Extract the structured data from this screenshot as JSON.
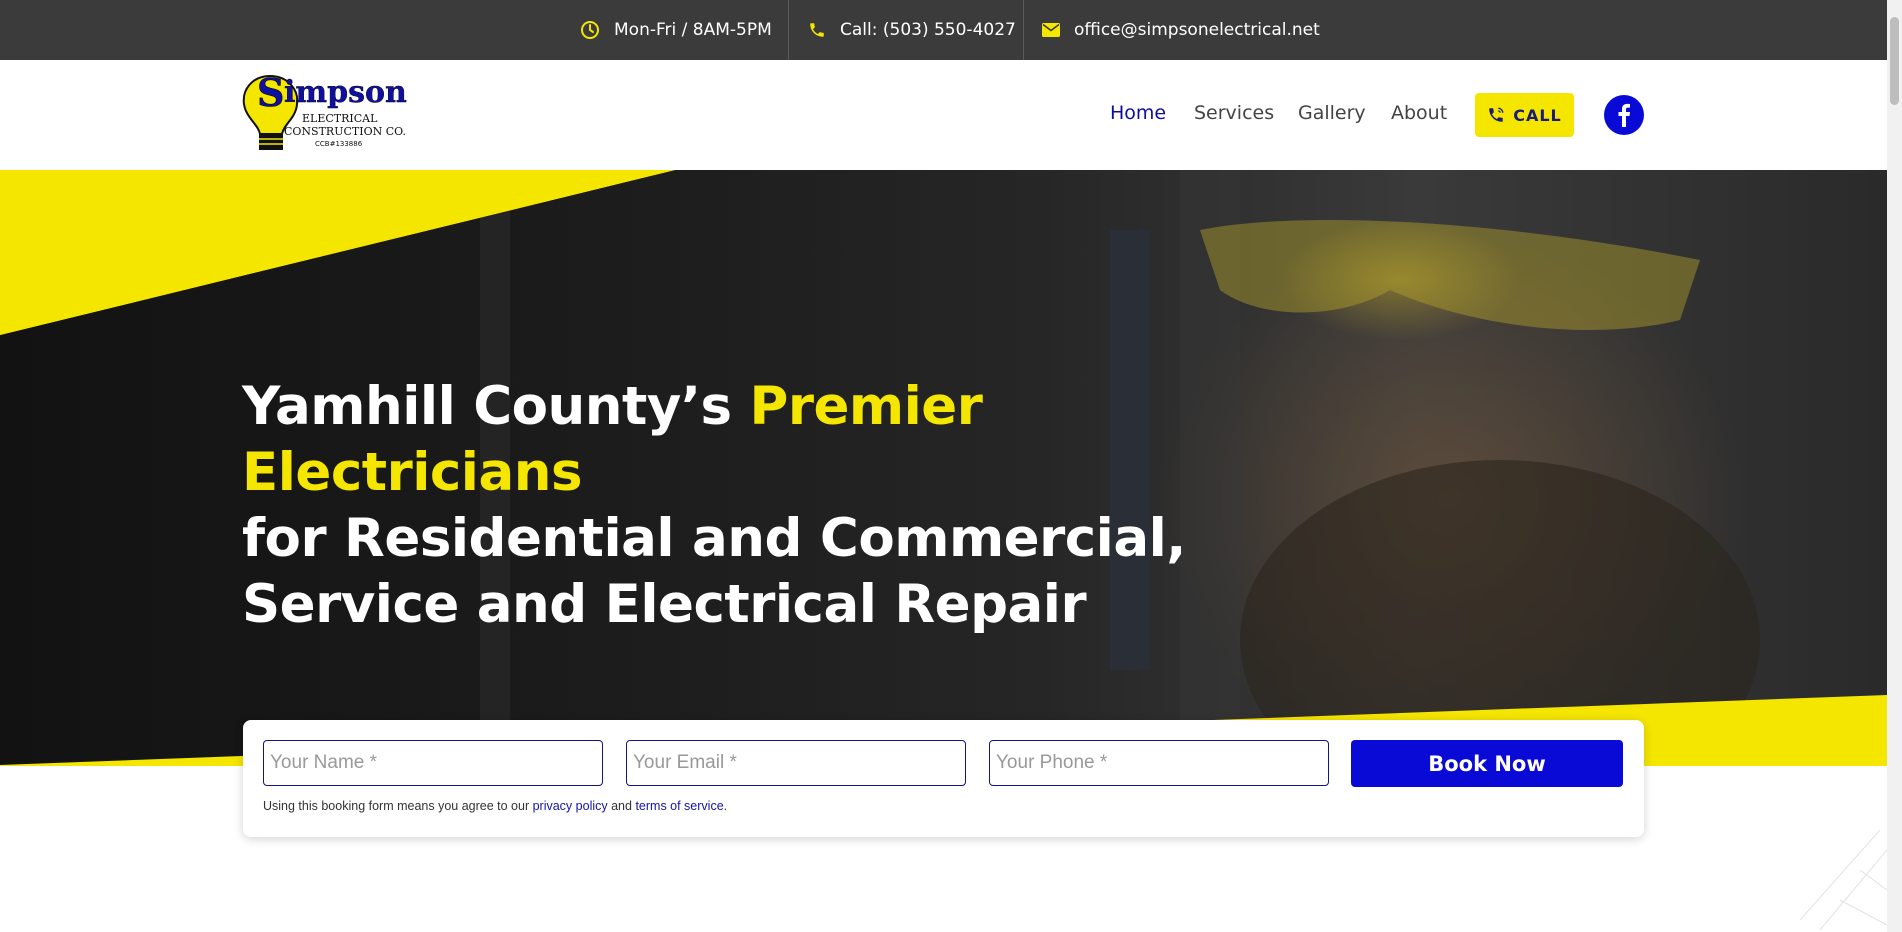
{
  "topbar": {
    "hours": "Mon-Fri / 8AM-5PM",
    "phone": "Call: (503) 550-4027",
    "email": "office@simpsonelectrical.net",
    "icons": {
      "hours": "clock-icon",
      "phone": "phone-icon",
      "email": "mail-icon"
    }
  },
  "header": {
    "logo": {
      "name": "Simpson",
      "line1": "ELECTRICAL",
      "line2": "CONSTRUCTION CO.",
      "ccb": "CCB#133886"
    },
    "nav": [
      {
        "label": "Home",
        "active": true
      },
      {
        "label": "Services",
        "active": false
      },
      {
        "label": "Gallery",
        "active": false
      },
      {
        "label": "About",
        "active": false
      }
    ],
    "call_label": "CALL",
    "facebook_icon": "facebook-icon"
  },
  "hero": {
    "headline_part1": "Yamhill County’s ",
    "headline_highlight": "Premier Electricians",
    "headline_line2": "for Residential and Commercial,",
    "headline_line3": "Service and Electrical Repair"
  },
  "booking": {
    "name_placeholder": "Your Name *",
    "email_placeholder": "Your Email *",
    "phone_placeholder": "Your Phone *",
    "submit_label": "Book Now",
    "disclaimer_prefix": "Using this booking form means you agree to our ",
    "privacy_label": "privacy policy",
    "and_text": " and ",
    "terms_label": "terms of service",
    "period": "."
  },
  "colors": {
    "accent_yellow": "#f5e600",
    "brand_blue": "#0a0ad6",
    "topbar_bg": "#3b3b3b"
  }
}
